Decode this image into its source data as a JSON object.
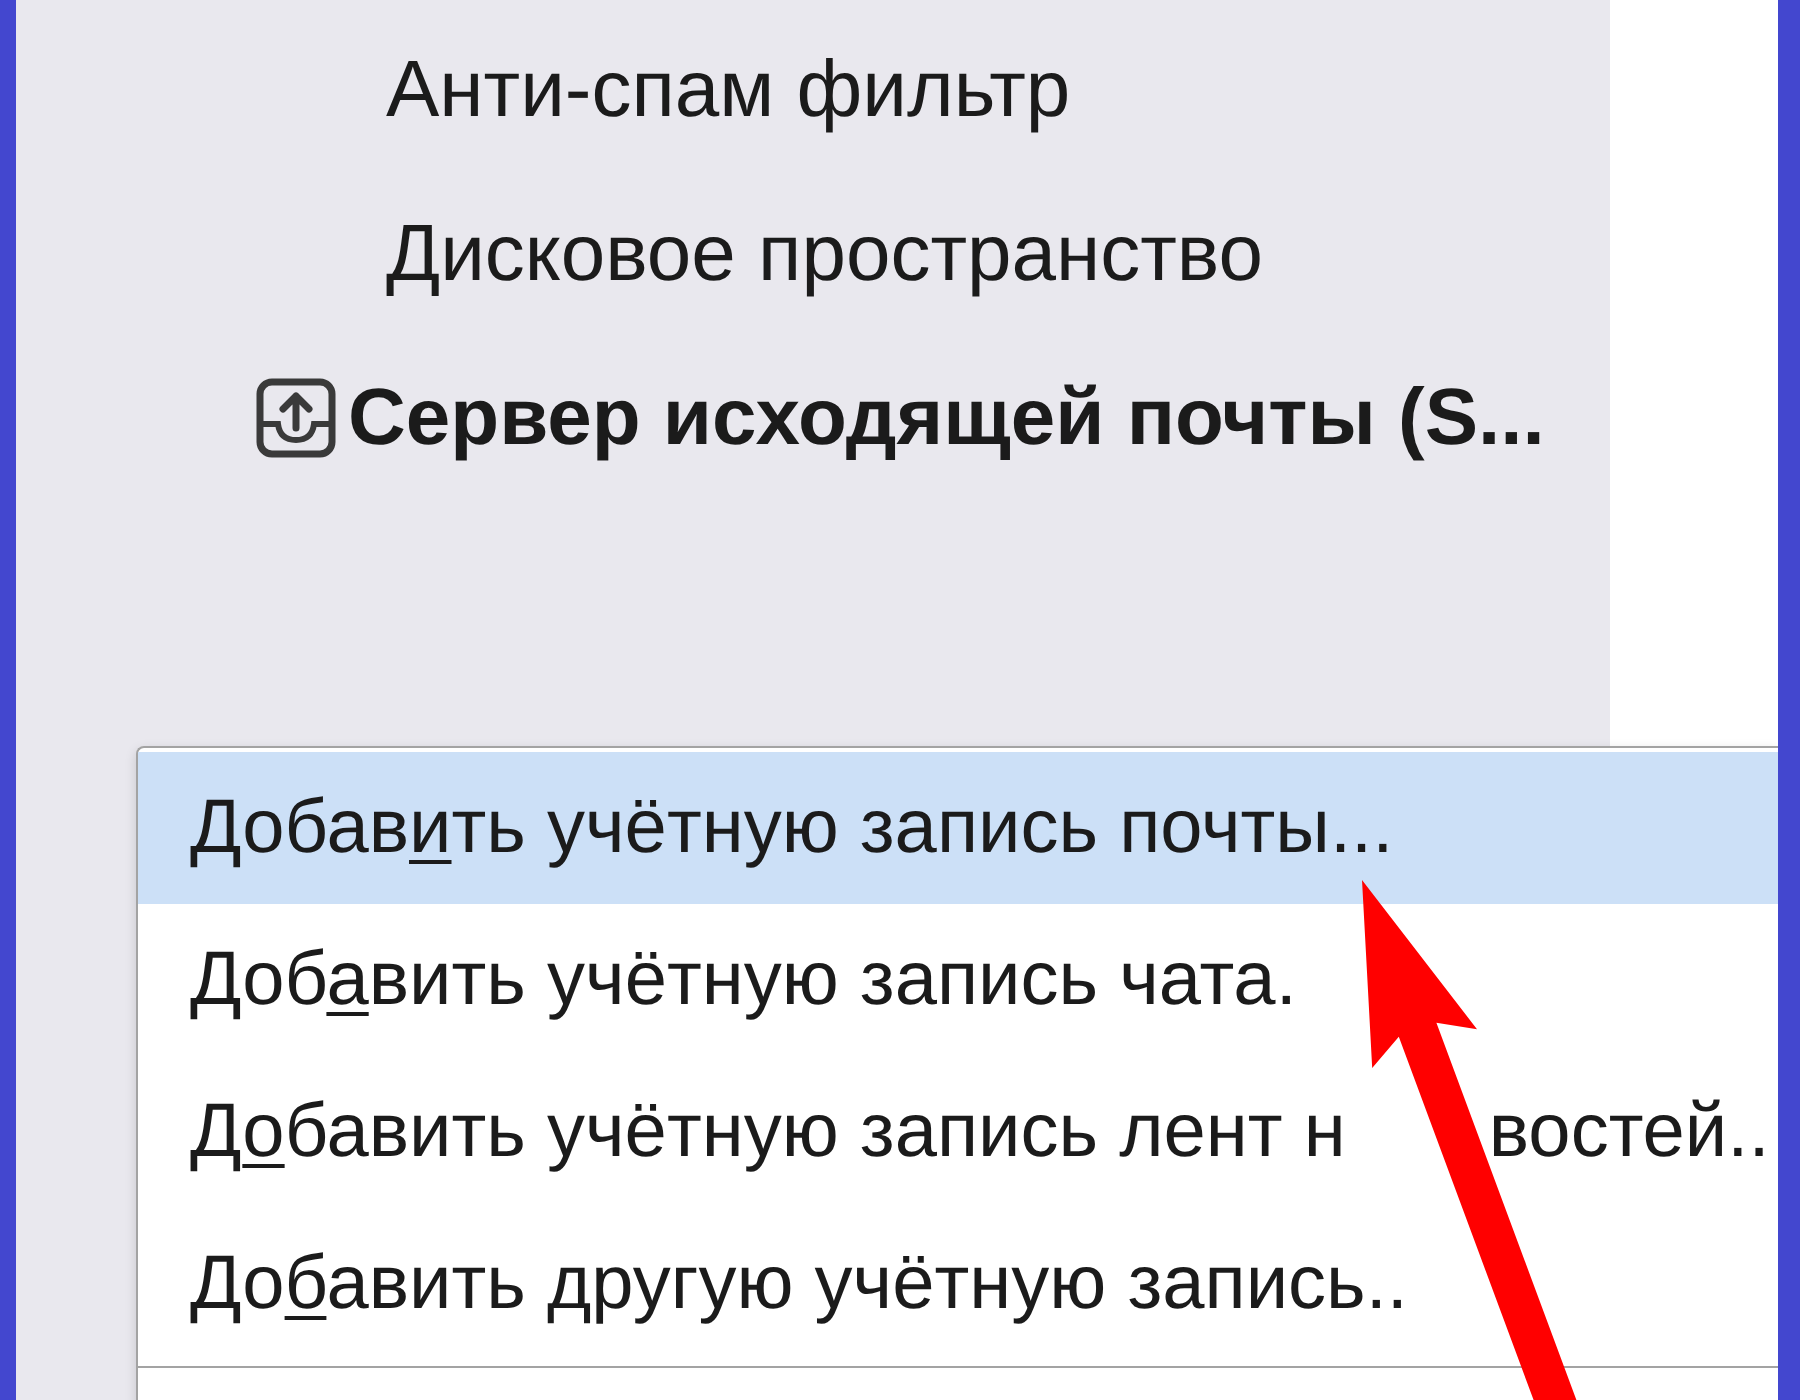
{
  "sidebar": {
    "items": [
      {
        "kind": "setting",
        "label": "Анти-спам фильтр"
      },
      {
        "kind": "setting",
        "label": "Дисковое пространство"
      },
      {
        "kind": "server",
        "label": "Сервер исходящей почты (S..."
      }
    ]
  },
  "context_menu": {
    "items": [
      {
        "selected": true,
        "parts": [
          {
            "kind": "plain",
            "text": "Добав"
          },
          {
            "kind": "access_key",
            "text": "и"
          },
          {
            "kind": "plain",
            "text": "ть учётную запись почты..."
          }
        ]
      },
      {
        "selected": false,
        "parts": [
          {
            "kind": "plain",
            "text": "Доб"
          },
          {
            "kind": "access_key",
            "text": "а"
          },
          {
            "kind": "plain",
            "text": "вить учётную запись чата."
          }
        ]
      },
      {
        "selected": false,
        "parts": [
          {
            "kind": "plain",
            "text": "Д"
          },
          {
            "kind": "access_key",
            "text": "о"
          },
          {
            "kind": "plain",
            "text": "бавить учётную запись лент н"
          },
          {
            "kind": "after_gap",
            "text": "востей.."
          }
        ]
      },
      {
        "selected": false,
        "parts": [
          {
            "kind": "plain",
            "text": "До"
          },
          {
            "kind": "access_key",
            "text": "б"
          },
          {
            "kind": "plain",
            "text": "авить другую учётную запись.."
          }
        ]
      }
    ]
  }
}
